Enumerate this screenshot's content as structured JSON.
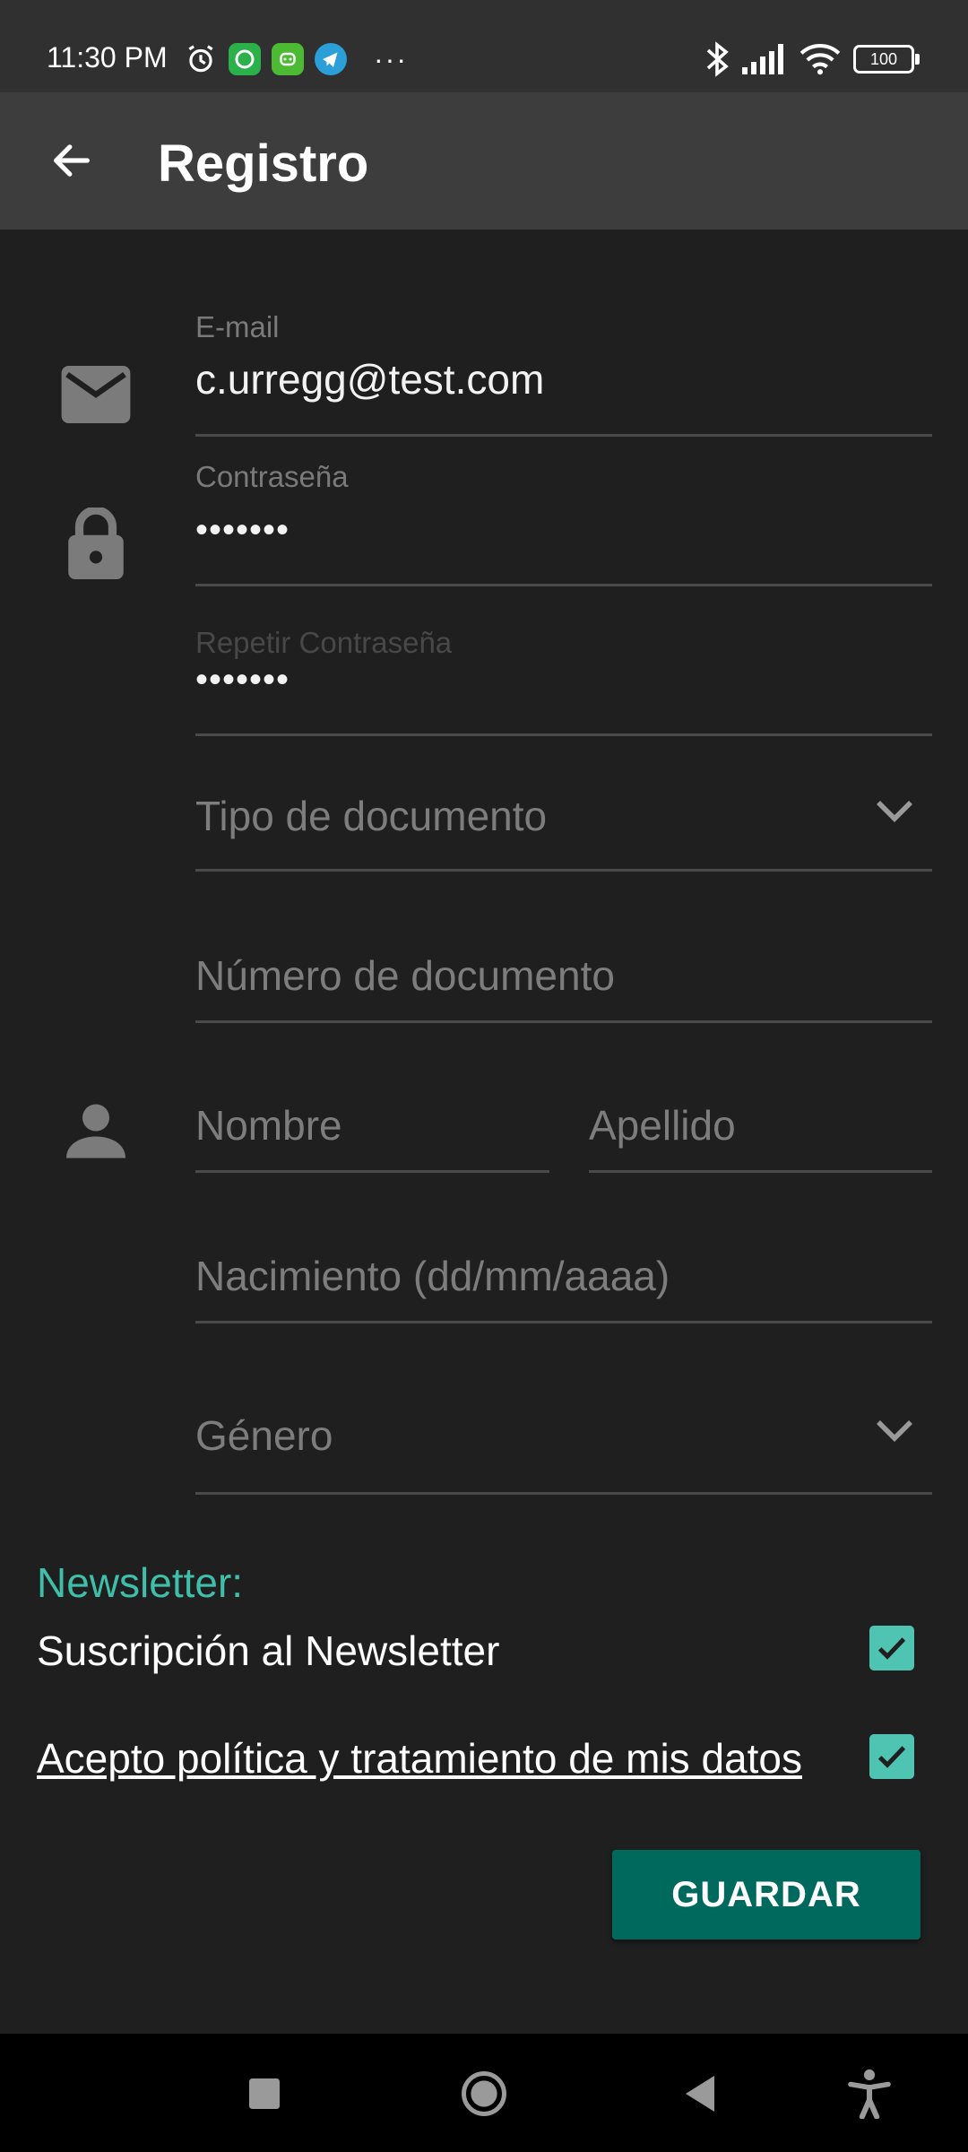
{
  "status_bar": {
    "time": "11:30 PM",
    "battery": "100",
    "notification_more": "···"
  },
  "app_bar": {
    "title": "Registro"
  },
  "form": {
    "email": {
      "label": "E-mail",
      "value": "c.urregg@test.com"
    },
    "password": {
      "label": "Contraseña",
      "value": "•••••••"
    },
    "repeat_password": {
      "label": "Repetir Contraseña",
      "value": "•••••••"
    },
    "document_type": {
      "placeholder": "Tipo de documento"
    },
    "document_number": {
      "placeholder": "Número de documento"
    },
    "first_name": {
      "placeholder": "Nombre"
    },
    "last_name": {
      "placeholder": "Apellido"
    },
    "birth_date": {
      "placeholder": "Nacimiento (dd/mm/aaaa)"
    },
    "gender": {
      "placeholder": "Género"
    }
  },
  "newsletter": {
    "heading": "Newsletter:",
    "subscription_label": "Suscripción al Newsletter",
    "subscription_checked": true,
    "policy_label": "Acepto política y tratamiento de mis datos",
    "policy_checked": true
  },
  "actions": {
    "save_label": "GUARDAR"
  },
  "colors": {
    "accent": "#3fbfaa",
    "checkbox": "#4fc4b3",
    "button": "#00695e",
    "background": "#1f1f1f",
    "app_bar": "#3d3d3d"
  },
  "icons": {
    "email": "email-icon",
    "password": "lock-icon",
    "name": "person-icon",
    "dropdown": "chevron-down-icon"
  }
}
